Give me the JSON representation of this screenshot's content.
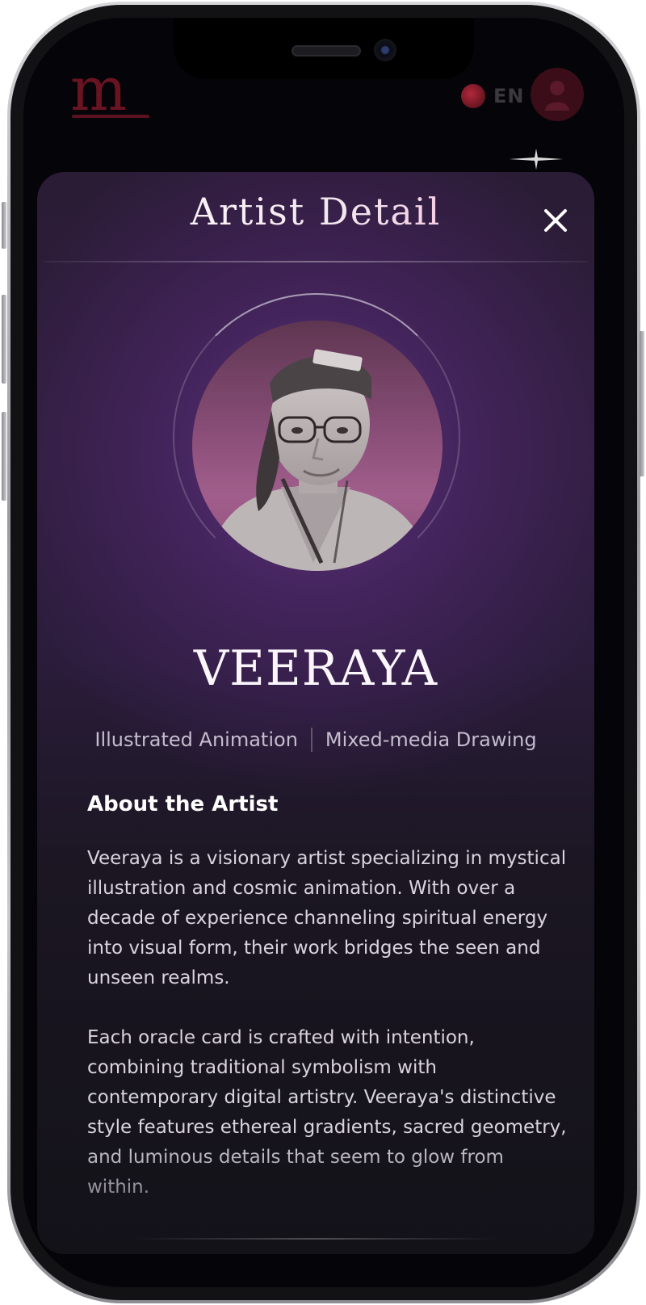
{
  "app": {
    "logo_text": "m",
    "language_label": "EN",
    "icons": {
      "flag": "thai-flag-icon",
      "profile": "user-icon",
      "sparkle": "sparkle-icon"
    }
  },
  "modal": {
    "title": "Artist Detail",
    "close_icon": "close-icon"
  },
  "artist": {
    "name": "VEERAYA",
    "tags": [
      "Illustrated Animation",
      "Mixed-media Drawing"
    ],
    "about_heading": "About the Artist",
    "bio": [
      "Veeraya is a visionary artist specializing in mystical illustration and cosmic animation. With over a decade of experience channeling spiritual energy into visual form, their work bridges the seen and unseen realms.",
      "Each oracle card is crafted with intention, combining traditional symbolism with contemporary digital artistry. Veeraya's distinctive style features ethereal gradients, sacred geometry, and luminous details that seem to glow from within."
    ]
  },
  "colors": {
    "accent_pink": "#f3a7d0",
    "modal_purple": "#623482",
    "background": "#050408"
  }
}
